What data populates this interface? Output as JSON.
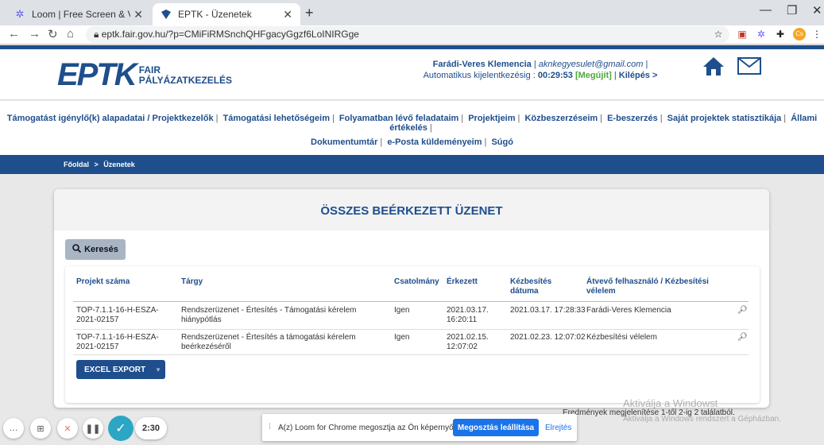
{
  "browser": {
    "tabs": [
      {
        "title": "Loom | Free Screen & Video Reco",
        "icon": "loom-icon"
      },
      {
        "title": "EPTK - Üzenetek",
        "icon": "eptk-favicon"
      }
    ],
    "url": "eptk.fair.gov.hu/?p=CMiFiRMSnchQHFgacyGgzf6LoINIRGge",
    "profile_initials": "Cs"
  },
  "header": {
    "logo_main": "EPTK",
    "logo_sub1": "FAIR",
    "logo_sub2": "PÁLYÁZATKEZELÉS",
    "user_name": "Farádi-Veres Klemencia",
    "user_email": "aknkegyesulet@gmail.com",
    "logout_label": "Automatikus kijelentkezésig :",
    "countdown": "00:29:53",
    "renew": "[Megújít]",
    "exit": "Kilépés >"
  },
  "nav": {
    "row1": [
      "Támogatást igénylő(k) alapadatai / Projektkezelők",
      "Támogatási lehetőségeim",
      "Folyamatban lévő feladataim",
      "Projektjeim",
      "Közbeszerzéseim",
      "E-beszerzés",
      "Saját projektek statisztikája",
      "Állami értékelés"
    ],
    "row2": [
      "Dokumentumtár",
      "e-Posta küldeményeim",
      "Súgó"
    ]
  },
  "breadcrumb": {
    "home": "Főoldal",
    "sep": ">",
    "current": "Üzenetek"
  },
  "main": {
    "title": "ÖSSZES BEÉRKEZETT ÜZENET",
    "search_label": "Keresés",
    "table": {
      "headers": [
        "Projekt száma",
        "Tárgy",
        "Csatolmány",
        "Érkezett",
        "Kézbesítés dátuma",
        "Átvevő felhasználó / Kézbesítési vélelem"
      ],
      "rows": [
        {
          "project": "TOP-7.1.1-16-H-ESZA-2021-02157",
          "subject": "Rendszerüzenet - Értesítés - Támogatási kérelem hiánypótlás",
          "attachment": "Igen",
          "received": "2021.03.17. 16:20:11",
          "delivered": "2021.03.17. 17:28:33",
          "recipient": "Farádi-Veres Klemencia"
        },
        {
          "project": "TOP-7.1.1-16-H-ESZA-2021-02157",
          "subject": "Rendszerüzenet - Értesítés a támogatási kérelem beérkezéséről",
          "attachment": "Igen",
          "received": "2021.02.15. 12:07:02",
          "delivered": "2021.02.23. 12:07:02",
          "recipient": "Kézbesítési vélelem"
        }
      ]
    },
    "export_label": "EXCEL EXPORT",
    "results_text": "Eredmények megjelenítése 1-től 2-ig 2 találatból."
  },
  "overlay": {
    "watermark_title": "Aktiválja a Windowst",
    "watermark_sub": "Aktiválja a Windows rendszert a Gépházban.",
    "loom_timer": "2:30",
    "share_msg": "A(z) Loom for Chrome megosztja az Ön képernyőjét.",
    "share_stop": "Megosztás leállítása",
    "share_hide": "Elrejtés"
  },
  "colors": {
    "brand": "#1f4e8c",
    "accent_green": "#4caa3a",
    "loom_teal": "#2ca6c4",
    "chrome_blue": "#1a73e8"
  }
}
